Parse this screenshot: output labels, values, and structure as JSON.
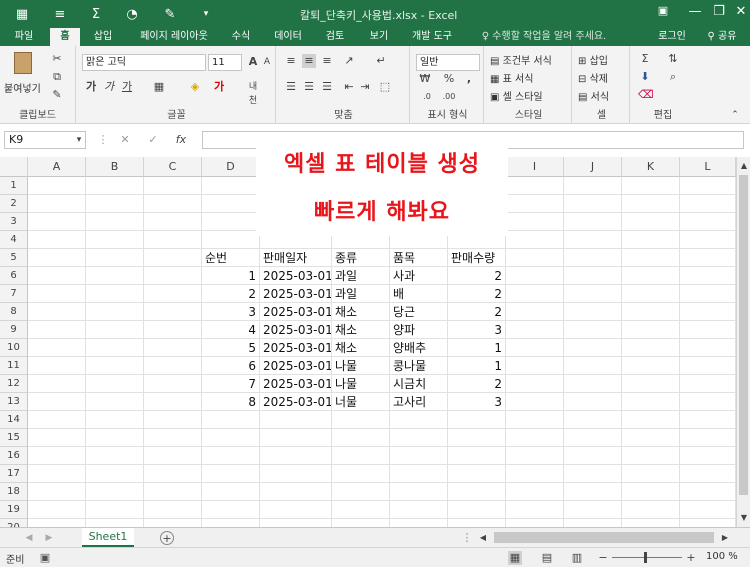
{
  "window": {
    "title": "칼퇴_단축키_사용법.xlsx - Excel",
    "minimize": "—",
    "restore": "❐",
    "close": "✕"
  },
  "ribbon_tabs": [
    "파일",
    "홈",
    "삽입",
    "페이지 레이아웃",
    "수식",
    "데이터",
    "검토",
    "보기",
    "개발 도구"
  ],
  "tell_me": "수행할 작업을 알려 주세요.",
  "account": {
    "login": "로그인",
    "share": "공유"
  },
  "ribbon": {
    "clipboard": {
      "paste": "붙여넣기",
      "label": "클립보드"
    },
    "font": {
      "name": "맑은 고딕",
      "size": "11",
      "label": "글꼴"
    },
    "alignment": {
      "label": "맞춤"
    },
    "number": {
      "format": "일반",
      "label": "표시 형식"
    },
    "styles": {
      "conditional": "조건부 서식",
      "table": "표 서식",
      "cell": "셀 스타일",
      "label": "스타일"
    },
    "cells": {
      "insert": "삽입",
      "delete": "삭제",
      "format": "서식",
      "label": "셀"
    },
    "editing": {
      "label": "편집"
    }
  },
  "formula_bar": {
    "name_box": "K9",
    "fx": "fx",
    "formula": ""
  },
  "columns": [
    "A",
    "B",
    "C",
    "D",
    "E",
    "F",
    "G",
    "H",
    "I",
    "J",
    "K",
    "L"
  ],
  "rows": [
    "1",
    "2",
    "3",
    "4",
    "5",
    "6",
    "7",
    "8",
    "9",
    "10",
    "11",
    "12",
    "13",
    "14",
    "15",
    "16",
    "17",
    "18",
    "19",
    "20"
  ],
  "table": {
    "headers": [
      "순번",
      "판매일자",
      "종류",
      "품목",
      "판매수량"
    ],
    "rows": [
      [
        "1",
        "2025-03-01",
        "과일",
        "사과",
        "2"
      ],
      [
        "2",
        "2025-03-01",
        "과일",
        "배",
        "2"
      ],
      [
        "3",
        "2025-03-01",
        "채소",
        "당근",
        "2"
      ],
      [
        "4",
        "2025-03-01",
        "채소",
        "양파",
        "3"
      ],
      [
        "5",
        "2025-03-01",
        "채소",
        "양배추",
        "1"
      ],
      [
        "6",
        "2025-03-01",
        "나물",
        "콩나물",
        "1"
      ],
      [
        "7",
        "2025-03-01",
        "나물",
        "시금치",
        "2"
      ],
      [
        "8",
        "2025-03-01",
        "너물",
        "고사리",
        "3"
      ]
    ]
  },
  "overlay": {
    "line1": "엑셀 표 테이블 생성",
    "line2": "빠르게 해봐요"
  },
  "sheet_tab": "Sheet1",
  "status": {
    "ready": "준비",
    "zoom": "100 %",
    "minus": "−",
    "plus": "+"
  },
  "colors": {
    "excel_green": "#217346",
    "overlay_red": "#e8161b"
  }
}
